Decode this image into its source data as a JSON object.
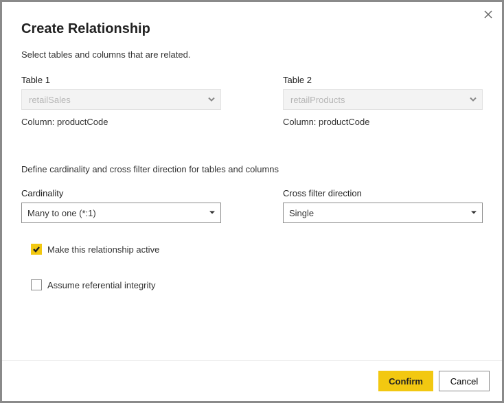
{
  "dialog": {
    "title": "Create Relationship",
    "subtitle": "Select tables and columns that are related."
  },
  "table1": {
    "label": "Table 1",
    "value": "retailSales",
    "columnPrefix": "Column: ",
    "column": "productCode"
  },
  "table2": {
    "label": "Table 2",
    "value": "retailProducts",
    "columnPrefix": "Column: ",
    "column": "productCode"
  },
  "sectionDesc": "Define cardinality and cross filter direction for tables and columns",
  "cardinality": {
    "label": "Cardinality",
    "value": "Many to one (*:1)"
  },
  "crossFilter": {
    "label": "Cross filter direction",
    "value": "Single"
  },
  "activeCheck": {
    "label": "Make this relationship active",
    "checked": true
  },
  "refIntegrity": {
    "label": "Assume referential integrity",
    "checked": false
  },
  "buttons": {
    "confirm": "Confirm",
    "cancel": "Cancel"
  }
}
